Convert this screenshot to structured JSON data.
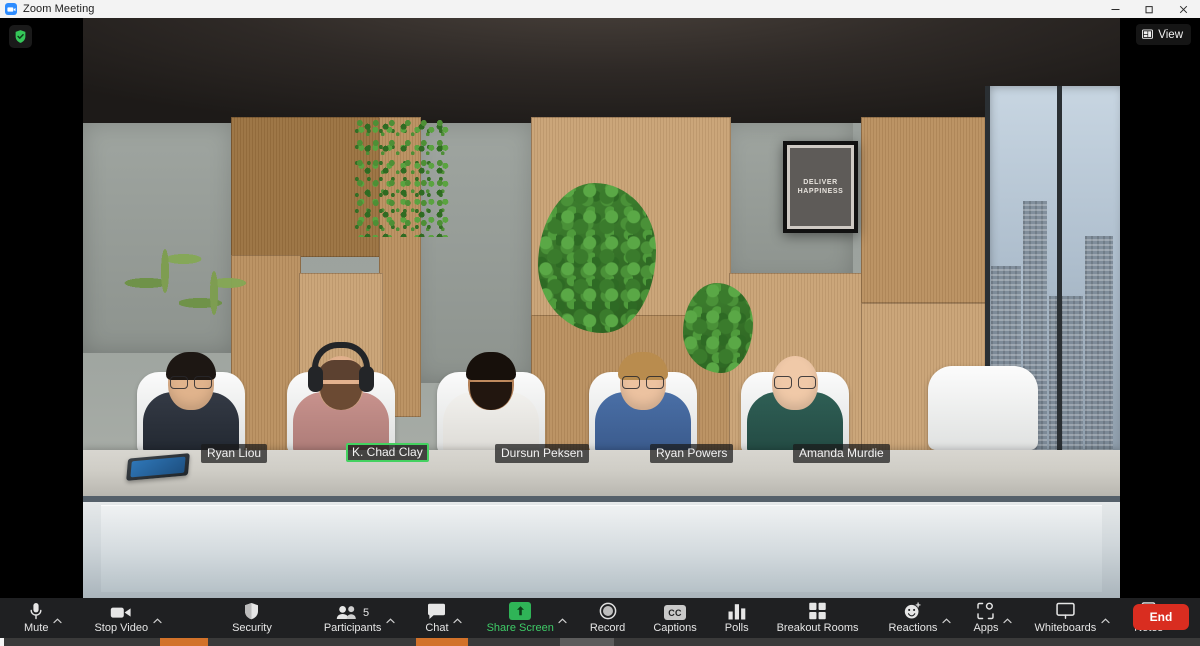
{
  "window": {
    "title": "Zoom Meeting",
    "logo_icon": "zoom-logo-icon",
    "minimize_icon": "minimize-icon",
    "maximize_icon": "maximize-icon",
    "close_icon": "close-icon"
  },
  "stage": {
    "encryption_badge_icon": "shield-check-icon",
    "view_button": {
      "label": "View",
      "icon": "layout-grid-icon"
    },
    "background": {
      "poster_text": "Deliver\nHappiness"
    }
  },
  "participants": [
    {
      "name": "Ryan Liou",
      "speaking": false
    },
    {
      "name": "K. Chad Clay",
      "speaking": true
    },
    {
      "name": "Dursun Peksen",
      "speaking": false
    },
    {
      "name": "Ryan Powers",
      "speaking": false
    },
    {
      "name": "Amanda Murdie",
      "speaking": false
    }
  ],
  "toolbar": {
    "items": [
      {
        "label": "Mute",
        "icon": "microphone-icon",
        "caret": true,
        "accent": false
      },
      {
        "label": "Stop Video",
        "icon": "video-camera-icon",
        "caret": true,
        "accent": false
      },
      {
        "label": "Security",
        "icon": "shield-icon",
        "caret": false,
        "accent": false
      },
      {
        "label": "Participants",
        "icon": "participants-icon",
        "caret": true,
        "accent": false,
        "count": "5"
      },
      {
        "label": "Chat",
        "icon": "chat-bubble-icon",
        "caret": true,
        "accent": false
      },
      {
        "label": "Share Screen",
        "icon": "share-screen-icon",
        "caret": true,
        "accent": true
      },
      {
        "label": "Record",
        "icon": "record-icon",
        "caret": false,
        "accent": false
      },
      {
        "label": "Captions",
        "icon": "closed-caption-icon",
        "caret": false,
        "accent": false,
        "cc_text": "CC"
      },
      {
        "label": "Polls",
        "icon": "polls-bar-icon",
        "caret": false,
        "accent": false
      },
      {
        "label": "Breakout Rooms",
        "icon": "breakout-rooms-icon",
        "caret": false,
        "accent": false
      },
      {
        "label": "Reactions",
        "icon": "reactions-icon",
        "caret": true,
        "accent": false
      },
      {
        "label": "Apps",
        "icon": "apps-icon",
        "caret": true,
        "accent": false
      },
      {
        "label": "Whiteboards",
        "icon": "whiteboard-icon",
        "caret": true,
        "accent": false
      },
      {
        "label": "Notes",
        "icon": "notes-icon",
        "caret": true,
        "accent": false
      }
    ],
    "end_button": {
      "label": "End"
    }
  },
  "colors": {
    "accent_green": "#3ecb67",
    "share_green": "#2fb457",
    "end_red": "#d92d20",
    "speaking_border": "#44d160",
    "toolbar_bg": "#1f2022",
    "titlebar_bg": "#f3f3f3",
    "taskbar_highlight": "#d2722a"
  }
}
